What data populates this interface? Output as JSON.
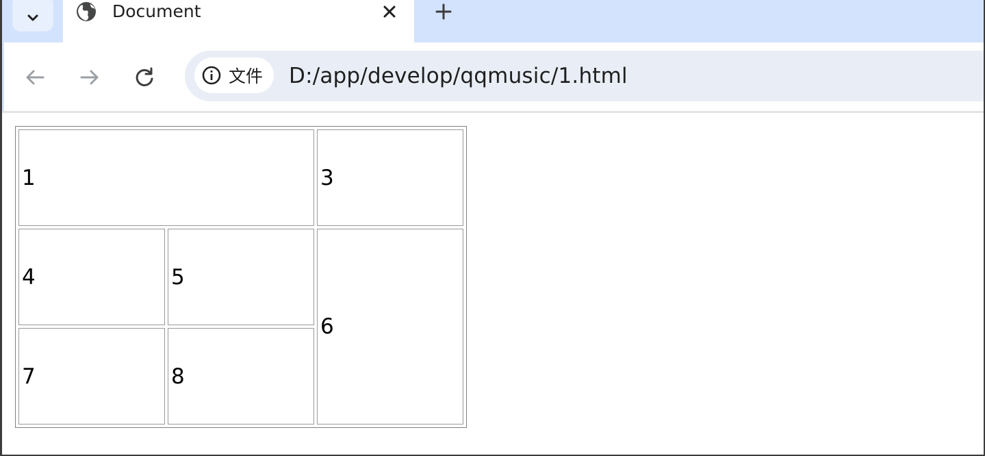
{
  "browser": {
    "tab": {
      "title": "Document",
      "favicon": "globe-icon",
      "close_icon": "close-icon"
    },
    "tab_search_icon": "chevron-down-icon",
    "new_tab_icon": "plus-icon",
    "nav": {
      "back_icon": "arrow-left-icon",
      "forward_icon": "arrow-right-icon",
      "reload_icon": "reload-icon"
    },
    "omnibox": {
      "site_info_icon": "info-icon",
      "site_chip_label": "文件",
      "url": "D:/app/develop/qqmusic/1.html"
    },
    "colors": {
      "tabstrip": "#d3e3fd",
      "omnibox": "#e9eef6"
    }
  },
  "page": {
    "table": {
      "rows": [
        [
          {
            "text": "1",
            "colspan": 2,
            "rowspan": 1
          },
          {
            "text": "3",
            "colspan": 1,
            "rowspan": 1
          }
        ],
        [
          {
            "text": "4",
            "colspan": 1,
            "rowspan": 1
          },
          {
            "text": "5",
            "colspan": 1,
            "rowspan": 1
          },
          {
            "text": "6",
            "colspan": 1,
            "rowspan": 2
          }
        ],
        [
          {
            "text": "7",
            "colspan": 1,
            "rowspan": 1
          },
          {
            "text": "8",
            "colspan": 1,
            "rowspan": 1
          }
        ]
      ]
    }
  }
}
